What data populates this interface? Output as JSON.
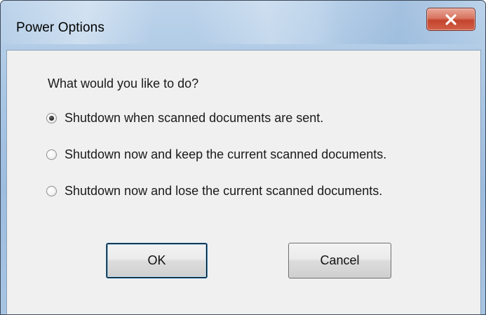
{
  "window": {
    "title": "Power Options",
    "close_glyph": "X"
  },
  "dialog": {
    "prompt": "What would you like to do?",
    "options": [
      {
        "label": "Shutdown when scanned documents are sent.",
        "checked": true
      },
      {
        "label": "Shutdown now and keep the current scanned documents.",
        "checked": false
      },
      {
        "label": "Shutdown now and lose the current scanned documents.",
        "checked": false
      }
    ],
    "buttons": {
      "ok_label": "OK",
      "cancel_label": "Cancel"
    }
  },
  "colors": {
    "title_bar": "#a9c6e4",
    "close_button": "#c4442d",
    "client_background": "#f0f0f0",
    "default_button_focus": "#3c7fb1"
  },
  "icons": {
    "close": "close-icon",
    "radio_selected": "radio-checked-icon",
    "radio_unselected": "radio-unchecked-icon"
  }
}
